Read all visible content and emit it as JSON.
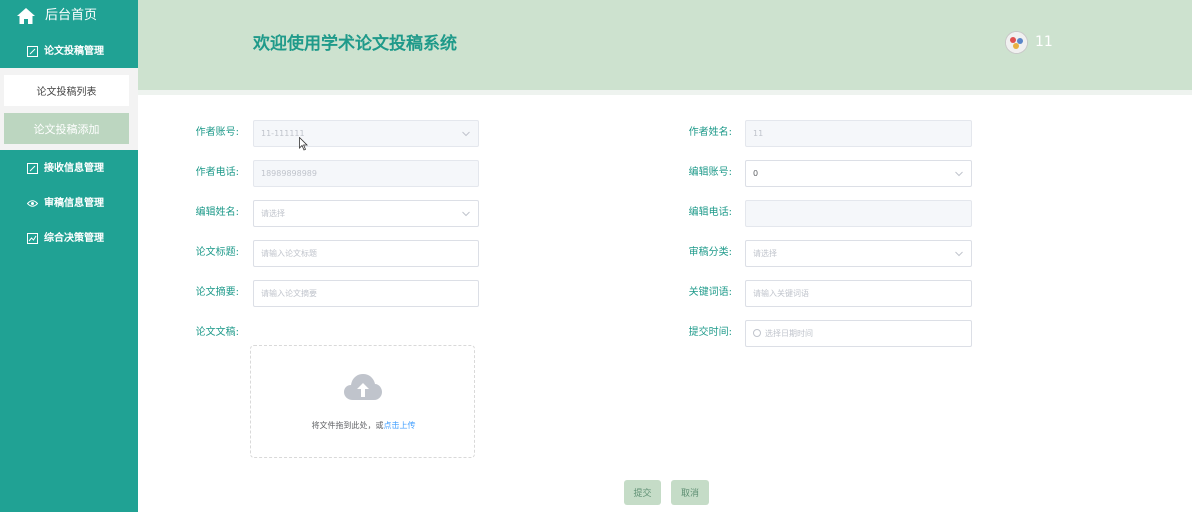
{
  "sidebar": {
    "home": "后台首页",
    "menu": [
      {
        "label": "论文投稿管理",
        "icon": "edit-icon"
      },
      {
        "label": "接收信息管理",
        "icon": "edit-icon"
      },
      {
        "label": "审稿信息管理",
        "icon": "eye-icon"
      },
      {
        "label": "综合决策管理",
        "icon": "chart-icon"
      }
    ],
    "submenu": {
      "list": "论文投稿列表",
      "add": "论文投稿添加"
    }
  },
  "header": {
    "title": "欢迎使用学术论文投稿系统",
    "username": "11"
  },
  "form": {
    "author_account": {
      "label": "作者账号:",
      "value": "11-111111"
    },
    "author_name": {
      "label": "作者姓名:",
      "value": "11"
    },
    "author_phone": {
      "label": "作者电话:",
      "value": "18989898989"
    },
    "editor_account": {
      "label": "编辑账号:",
      "value": "0"
    },
    "editor_name": {
      "label": "编辑姓名:",
      "placeholder": "请选择"
    },
    "editor_phone": {
      "label": "编辑电话:",
      "value": ""
    },
    "paper_title": {
      "label": "论文标题:",
      "placeholder": "请输入论文标题"
    },
    "review_category": {
      "label": "审稿分类:",
      "placeholder": "请选择"
    },
    "paper_abstract": {
      "label": "论文摘要:",
      "placeholder": "请输入论文摘要"
    },
    "keywords": {
      "label": "关键词语:",
      "placeholder": "请输入关键词语"
    },
    "paper_file": {
      "label": "论文文稿:"
    },
    "submit_time": {
      "label": "提交时间:",
      "placeholder": "选择日期时间"
    },
    "upload": {
      "hint": "将文件拖到此处，或",
      "link": "点击上传"
    }
  },
  "buttons": {
    "submit": "提交",
    "cancel": "取消"
  },
  "colors": {
    "sidebar": "#20a294",
    "header": "#cde2cf",
    "accent": "#1e9a8a",
    "button": "#c5dcc7"
  }
}
